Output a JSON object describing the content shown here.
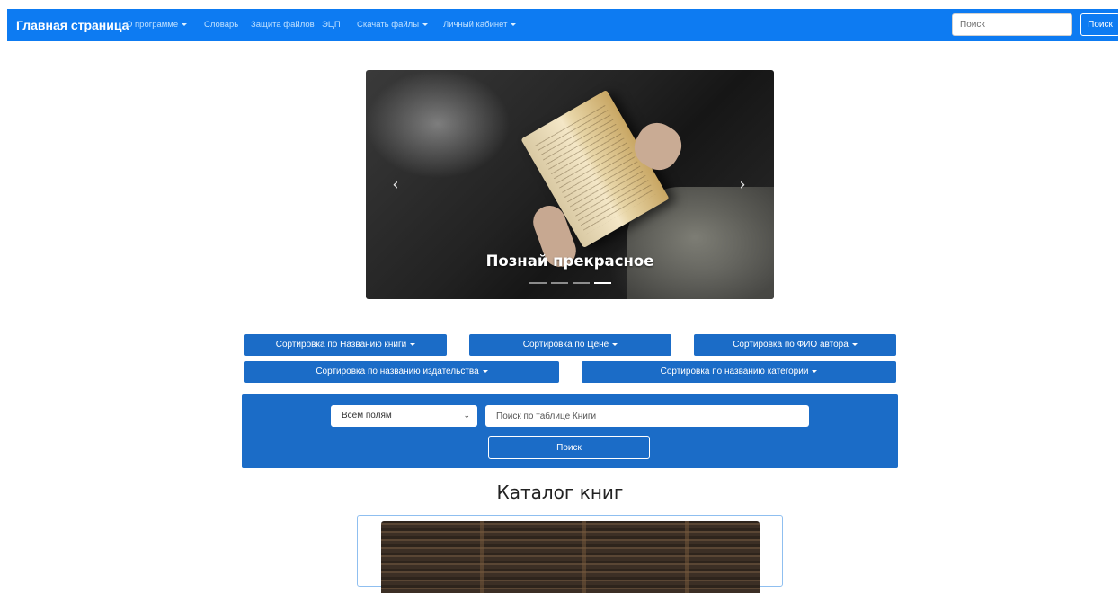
{
  "navbar": {
    "brand": "Главная страница",
    "links": [
      {
        "label": "О программе",
        "dropdown": true
      },
      {
        "label": "Словарь",
        "dropdown": false
      },
      {
        "label": "Защита файлов",
        "dropdown": false
      },
      {
        "label": "ЭЦП",
        "dropdown": false
      },
      {
        "label": "Скачать файлы",
        "dropdown": true
      },
      {
        "label": "Личный кабинет",
        "dropdown": true
      }
    ],
    "search_placeholder": "Поиск",
    "search_button": "Поиск",
    "colors": {
      "background": "#0d7bf2",
      "link": "#bfe0ff"
    }
  },
  "carousel": {
    "caption": "Познай прекрасное",
    "slide_count": 4,
    "active_slide": 4,
    "prev_icon": "chevron-left-icon",
    "next_icon": "chevron-right-icon"
  },
  "sort_buttons": [
    {
      "label": "Сортировка по Названию книги"
    },
    {
      "label": "Сортировка по Цене"
    },
    {
      "label": "Сортировка по ФИО автора"
    },
    {
      "label": "Сортировка по названию издательства"
    },
    {
      "label": "Сортировка по названию категории"
    }
  ],
  "filter": {
    "field_select_value": "Всем полям",
    "search_placeholder": "Поиск по таблице Книги",
    "search_button": "Поиск",
    "panel_color": "#1b6cc7"
  },
  "catalog": {
    "title": "Каталог книг"
  }
}
